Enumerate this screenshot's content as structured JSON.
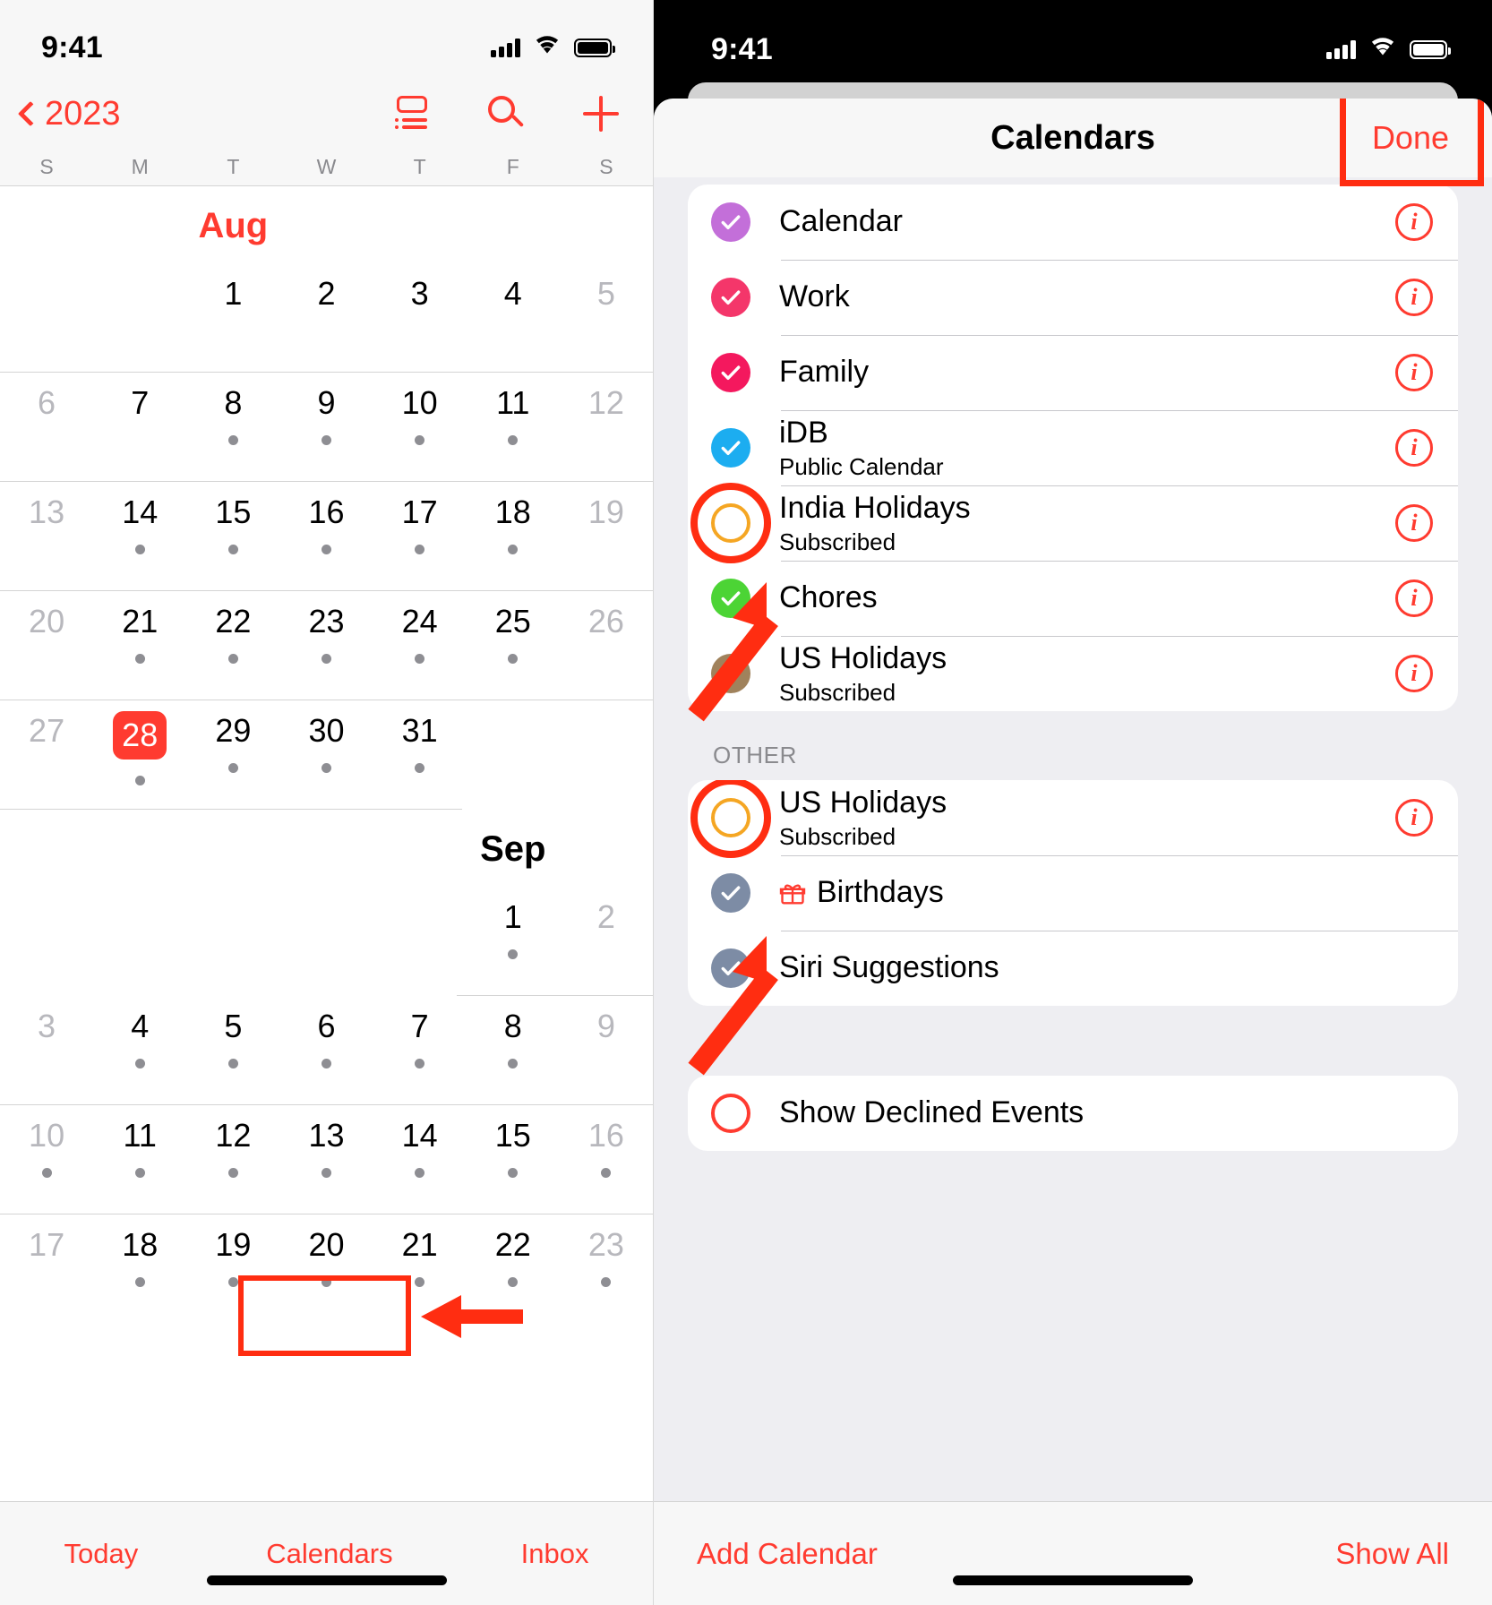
{
  "left_phone": {
    "status": {
      "time": "9:41",
      "signal_icon": "cellular-bars-icon",
      "wifi_icon": "wifi-icon",
      "battery_icon": "battery-full-icon"
    },
    "nav": {
      "back_label": "2023",
      "back_icon": "chevron-left-icon",
      "list_icon": "calendar-list-view-icon",
      "search_icon": "search-icon",
      "add_icon": "plus-icon"
    },
    "weekdays": [
      "S",
      "M",
      "T",
      "W",
      "T",
      "F",
      "S"
    ],
    "months": [
      {
        "name": "Aug",
        "accent": "#ff3b30",
        "rows": [
          [
            {
              "day": "",
              "dim": false,
              "dot": false,
              "empty": true
            },
            {
              "day": "",
              "dim": false,
              "dot": false,
              "empty": true
            },
            {
              "day": "1",
              "dim": false,
              "dot": false
            },
            {
              "day": "2",
              "dim": false,
              "dot": false
            },
            {
              "day": "3",
              "dim": false,
              "dot": false
            },
            {
              "day": "4",
              "dim": false,
              "dot": false
            },
            {
              "day": "5",
              "dim": true,
              "dot": false
            }
          ],
          [
            {
              "day": "6",
              "dim": true,
              "dot": false
            },
            {
              "day": "7",
              "dim": false,
              "dot": false
            },
            {
              "day": "8",
              "dim": false,
              "dot": true
            },
            {
              "day": "9",
              "dim": false,
              "dot": true
            },
            {
              "day": "10",
              "dim": false,
              "dot": true
            },
            {
              "day": "11",
              "dim": false,
              "dot": true
            },
            {
              "day": "12",
              "dim": true,
              "dot": false
            }
          ],
          [
            {
              "day": "13",
              "dim": true,
              "dot": false
            },
            {
              "day": "14",
              "dim": false,
              "dot": true
            },
            {
              "day": "15",
              "dim": false,
              "dot": true
            },
            {
              "day": "16",
              "dim": false,
              "dot": true
            },
            {
              "day": "17",
              "dim": false,
              "dot": true
            },
            {
              "day": "18",
              "dim": false,
              "dot": true
            },
            {
              "day": "19",
              "dim": true,
              "dot": false
            }
          ],
          [
            {
              "day": "20",
              "dim": true,
              "dot": false
            },
            {
              "day": "21",
              "dim": false,
              "dot": true
            },
            {
              "day": "22",
              "dim": false,
              "dot": true
            },
            {
              "day": "23",
              "dim": false,
              "dot": true
            },
            {
              "day": "24",
              "dim": false,
              "dot": true
            },
            {
              "day": "25",
              "dim": false,
              "dot": true
            },
            {
              "day": "26",
              "dim": true,
              "dot": false
            }
          ],
          [
            {
              "day": "27",
              "dim": true,
              "dot": false
            },
            {
              "day": "28",
              "dim": false,
              "dot": true,
              "today": true
            },
            {
              "day": "29",
              "dim": false,
              "dot": true
            },
            {
              "day": "30",
              "dim": false,
              "dot": true
            },
            {
              "day": "31",
              "dim": false,
              "dot": true
            },
            {
              "day": "",
              "dim": false,
              "dot": false,
              "empty": true
            },
            {
              "day": "",
              "dim": false,
              "dot": false,
              "empty": true
            }
          ]
        ]
      },
      {
        "name": "Sep",
        "accent": "#000000",
        "rows": [
          [
            {
              "day": "",
              "empty": true
            },
            {
              "day": "",
              "empty": true
            },
            {
              "day": "",
              "empty": true
            },
            {
              "day": "",
              "empty": true
            },
            {
              "day": "",
              "empty": true
            },
            {
              "day": "1",
              "dim": false,
              "dot": true
            },
            {
              "day": "2",
              "dim": true,
              "dot": false
            }
          ],
          [
            {
              "day": "3",
              "dim": true,
              "dot": false
            },
            {
              "day": "4",
              "dim": false,
              "dot": true
            },
            {
              "day": "5",
              "dim": false,
              "dot": true
            },
            {
              "day": "6",
              "dim": false,
              "dot": true
            },
            {
              "day": "7",
              "dim": false,
              "dot": true
            },
            {
              "day": "8",
              "dim": false,
              "dot": true
            },
            {
              "day": "9",
              "dim": true,
              "dot": false
            }
          ],
          [
            {
              "day": "10",
              "dim": true,
              "dot": true
            },
            {
              "day": "11",
              "dim": false,
              "dot": true
            },
            {
              "day": "12",
              "dim": false,
              "dot": true
            },
            {
              "day": "13",
              "dim": false,
              "dot": true
            },
            {
              "day": "14",
              "dim": false,
              "dot": true
            },
            {
              "day": "15",
              "dim": false,
              "dot": true
            },
            {
              "day": "16",
              "dim": true,
              "dot": true
            }
          ],
          [
            {
              "day": "17",
              "dim": true,
              "dot": false
            },
            {
              "day": "18",
              "dim": false,
              "dot": true
            },
            {
              "day": "19",
              "dim": false,
              "dot": true
            },
            {
              "day": "20",
              "dim": false,
              "dot": true
            },
            {
              "day": "21",
              "dim": false,
              "dot": true
            },
            {
              "day": "22",
              "dim": false,
              "dot": true
            },
            {
              "day": "23",
              "dim": true,
              "dot": true
            }
          ]
        ]
      }
    ],
    "tabbar": {
      "today": "Today",
      "calendars": "Calendars",
      "inbox": "Inbox"
    },
    "annotations": {
      "calendars_highlight_color": "#ff2d11",
      "arrow_color": "#ff2d11"
    }
  },
  "right_phone": {
    "status": {
      "time": "9:41",
      "signal_icon": "cellular-bars-icon",
      "wifi_icon": "wifi-icon",
      "battery_icon": "battery-full-icon"
    },
    "sheet": {
      "title": "Calendars",
      "done_label": "Done",
      "groups": [
        {
          "header": "",
          "items": [
            {
              "label": "Calendar",
              "sub": "",
              "state": "checked",
              "color": "#c36fd9",
              "info": true,
              "icon": ""
            },
            {
              "label": "Work",
              "sub": "",
              "state": "checked",
              "color": "#f4366a",
              "info": true,
              "icon": ""
            },
            {
              "label": "Family",
              "sub": "",
              "state": "checked",
              "color": "#f4185e",
              "info": true,
              "icon": ""
            },
            {
              "label": "iDB",
              "sub": "Public Calendar",
              "state": "checked",
              "color": "#1cadf0",
              "info": true,
              "icon": ""
            },
            {
              "label": "India Holidays",
              "sub": "Subscribed",
              "state": "unchecked-ring",
              "color": "#f5a623",
              "info": true,
              "icon": "",
              "highlighted": true
            },
            {
              "label": "Chores",
              "sub": "",
              "state": "checked",
              "color": "#4cd435",
              "info": true,
              "icon": ""
            },
            {
              "label": "US Holidays",
              "sub": "Subscribed",
              "state": "checked",
              "color": "#a0825c",
              "info": true,
              "icon": ""
            }
          ]
        },
        {
          "header": "OTHER",
          "items": [
            {
              "label": "US Holidays",
              "sub": "Subscribed",
              "state": "unchecked-ring",
              "color": "#f5a623",
              "info": true,
              "icon": "",
              "highlighted": true
            },
            {
              "label": "Birthdays",
              "sub": "",
              "state": "checked",
              "color": "#7d8ca5",
              "info": false,
              "icon": "gift-icon"
            },
            {
              "label": "Siri Suggestions",
              "sub": "",
              "state": "checked",
              "color": "#7d8ca5",
              "info": false,
              "icon": ""
            }
          ]
        },
        {
          "header": "",
          "items": [
            {
              "label": "Show Declined Events",
              "sub": "",
              "state": "open-circle",
              "color": "#ff3b30",
              "info": false,
              "icon": ""
            }
          ]
        }
      ]
    },
    "tabbar": {
      "add_calendar": "Add Calendar",
      "show_all": "Show All"
    },
    "annotations": {
      "done_highlight_color": "#ff2d11",
      "ring_highlight_color": "#ff2d11",
      "arrow_color": "#ff2d11"
    }
  }
}
